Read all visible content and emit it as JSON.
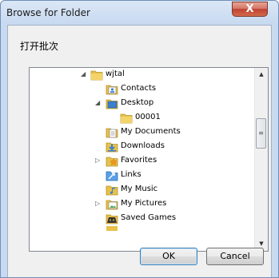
{
  "window": {
    "title": "Browse for Folder",
    "close_glyph": "X"
  },
  "dialog": {
    "description": "打开批次"
  },
  "tree": {
    "items": [
      {
        "label": "wjtal",
        "icon": "user-folder-icon",
        "expander": "expanded"
      },
      {
        "label": "Contacts",
        "icon": "contacts-folder-icon",
        "expander": "none"
      },
      {
        "label": "Desktop",
        "icon": "desktop-folder-icon",
        "expander": "expanded"
      },
      {
        "label": "00001",
        "icon": "folder-icon",
        "expander": "none"
      },
      {
        "label": "My Documents",
        "icon": "documents-folder-icon",
        "expander": "none"
      },
      {
        "label": "Downloads",
        "icon": "downloads-folder-icon",
        "expander": "none"
      },
      {
        "label": "Favorites",
        "icon": "favorites-folder-icon",
        "expander": "collapsed"
      },
      {
        "label": "Links",
        "icon": "links-folder-icon",
        "expander": "none"
      },
      {
        "label": "My Music",
        "icon": "music-folder-icon",
        "expander": "none"
      },
      {
        "label": "My Pictures",
        "icon": "pictures-folder-icon",
        "expander": "collapsed"
      },
      {
        "label": "Saved Games",
        "icon": "saved-games-folder-icon",
        "expander": "none"
      }
    ]
  },
  "scrollbar": {
    "up_glyph": "▲",
    "down_glyph": "▼",
    "grip": "≡"
  },
  "buttons": {
    "ok_label": "OK",
    "cancel_label": "Cancel"
  },
  "colors": {
    "folder_yellow": "#e7c14a",
    "special_blue": "#3a7fd0",
    "title_bar": "#c8daf0",
    "close_red": "#c04232"
  }
}
